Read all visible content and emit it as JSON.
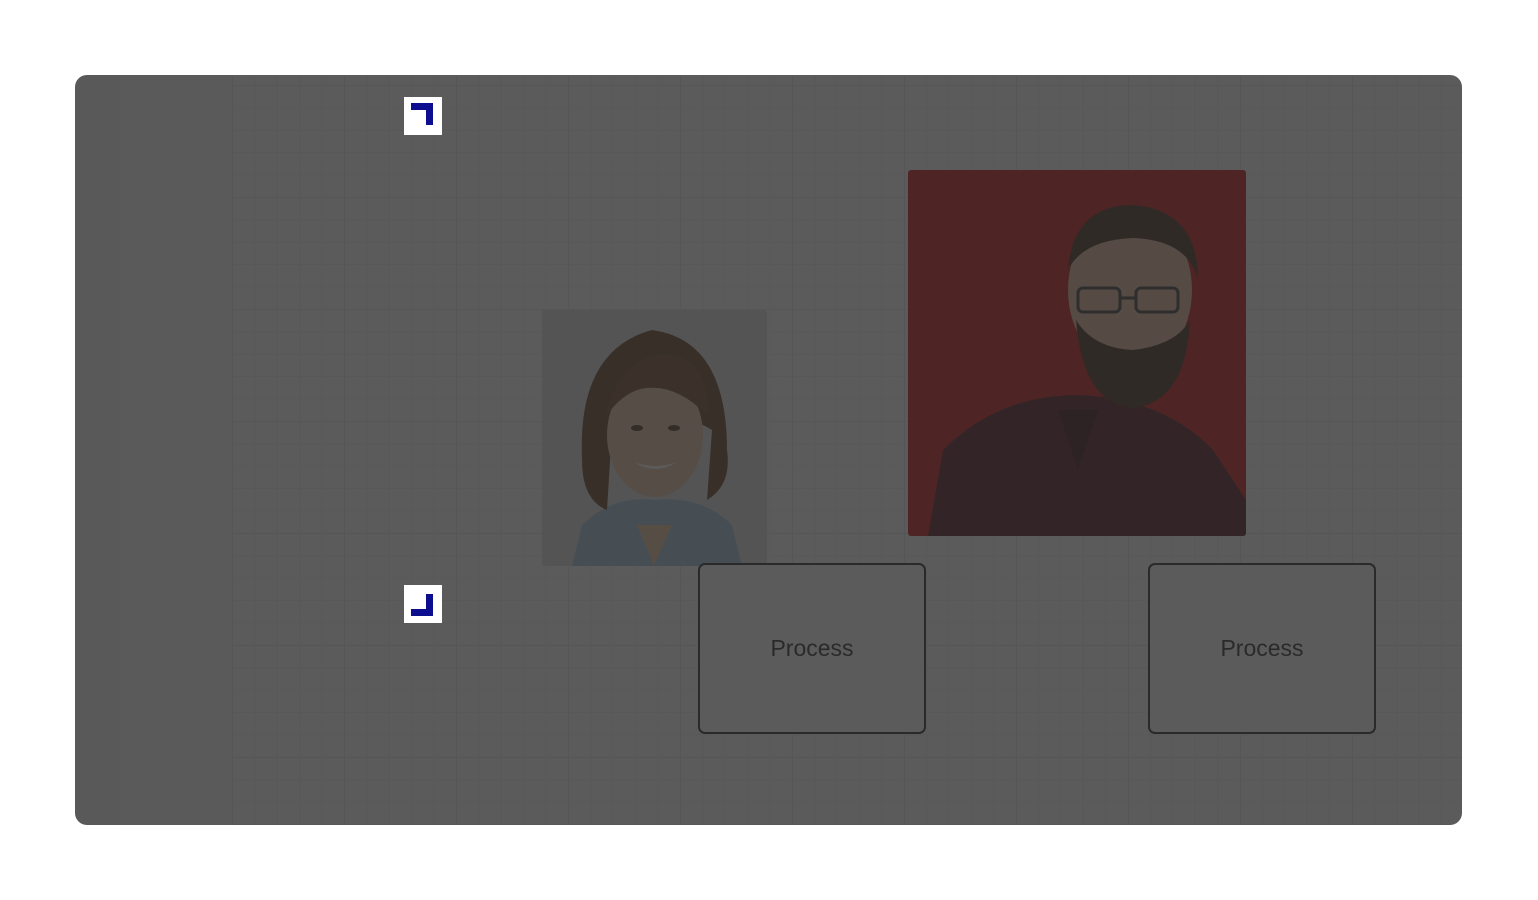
{
  "canvas": {
    "nodes": [
      {
        "type": "image",
        "icon": "portrait-long-hair-icon"
      },
      {
        "type": "image",
        "icon": "portrait-glasses-beard-icon"
      }
    ],
    "process_boxes": [
      {
        "label": "Process"
      },
      {
        "label": "Process"
      }
    ]
  },
  "overlay": {
    "color": "#282828",
    "handles": [
      {
        "icon": "corner-top-right-icon",
        "color": "#0d0d8f"
      },
      {
        "icon": "corner-bottom-right-icon",
        "color": "#0d0d8f"
      }
    ]
  }
}
